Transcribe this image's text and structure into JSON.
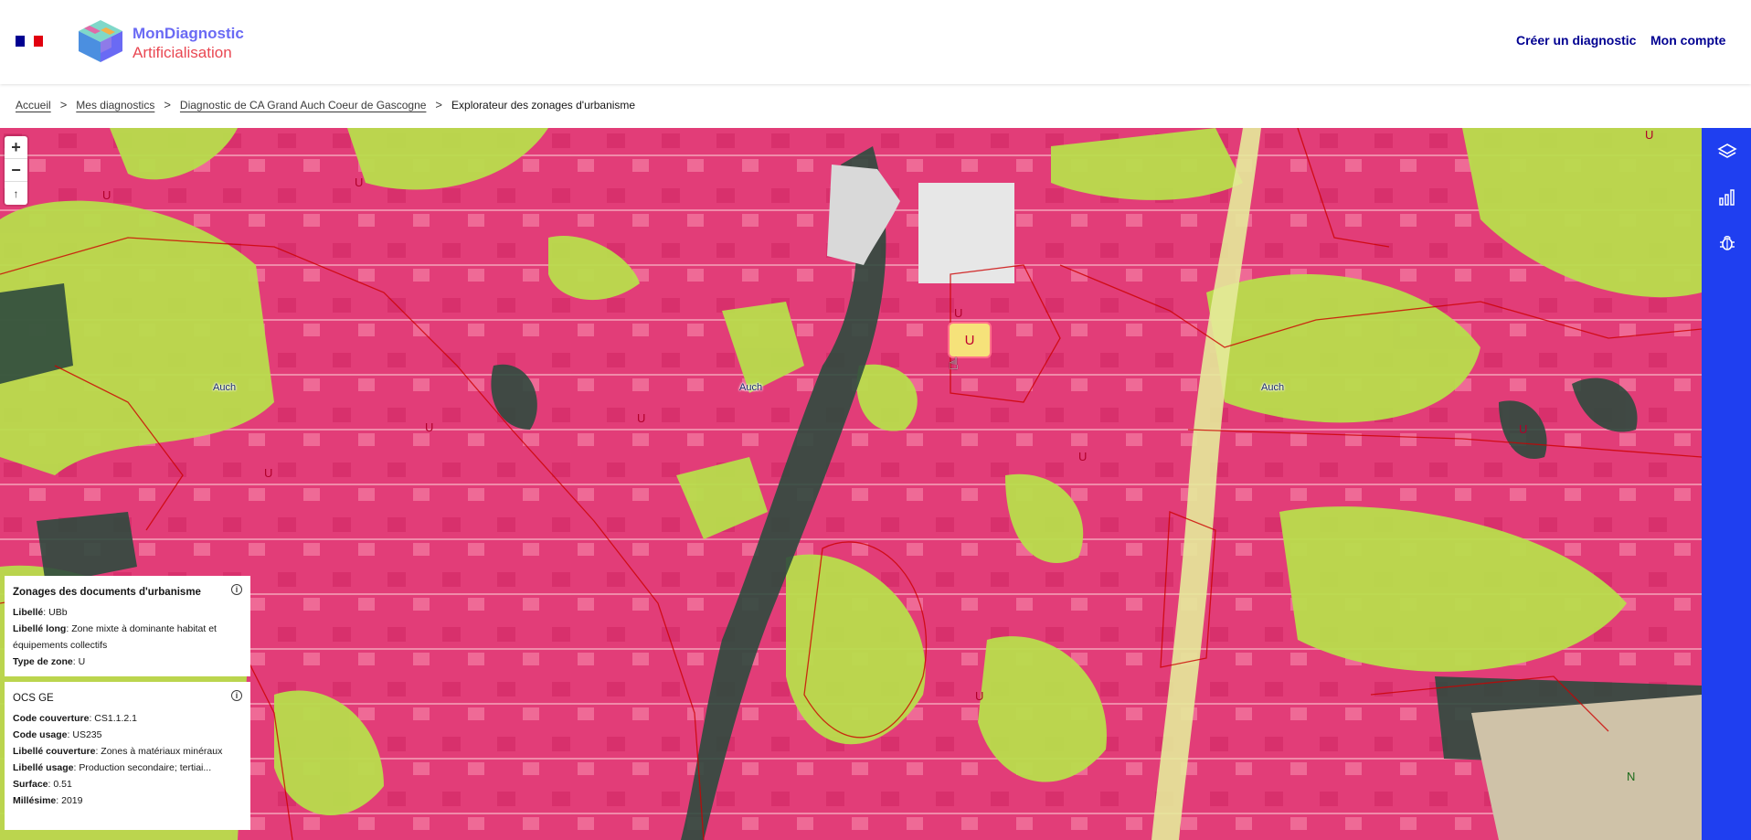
{
  "header": {
    "brand_line1": "MonDiagnostic",
    "brand_line2": "Artificialisation",
    "nav": [
      {
        "label": "Créer un diagnostic"
      },
      {
        "label": "Mon compte"
      }
    ]
  },
  "breadcrumb": {
    "items": [
      "Accueil",
      "Mes diagnostics",
      "Diagnostic de CA Grand Auch Coeur de Gascogne"
    ],
    "current": "Explorateur des zonages d'urbanisme",
    "separator": ">"
  },
  "map": {
    "zoom_in": "+",
    "zoom_out": "−",
    "reset_north": "↑",
    "places": [
      "Auch",
      "Auch",
      "Auch"
    ],
    "zone_letter": "U",
    "zone_letter_n": "N",
    "colors": {
      "built": "#e23d78",
      "vegetation": "#b8dd4c",
      "water": "#2f4a3e",
      "toolbar": "#1f3ff0"
    }
  },
  "toolbar": {
    "icons": [
      "layers-icon",
      "chart-icon",
      "bug-icon"
    ]
  },
  "panel_zonage": {
    "title": "Zonages des documents d'urbanisme",
    "rows": [
      {
        "key": "Libellé",
        "value": "UBb"
      },
      {
        "key": "Libellé long",
        "value": "Zone mixte à dominante habitat et équipements collectifs"
      },
      {
        "key": "Type de zone",
        "value": "U"
      }
    ]
  },
  "panel_ocsge": {
    "title": "OCS GE",
    "rows": [
      {
        "key": "Code couverture",
        "value": "CS1.1.2.1"
      },
      {
        "key": "Code usage",
        "value": "US235"
      },
      {
        "key": "Libellé couverture",
        "value": "Zones à matériaux minéraux"
      },
      {
        "key": "Libellé usage",
        "value": "Production secondaire; tertiai..."
      },
      {
        "key": "Surface",
        "value": "0.51"
      },
      {
        "key": "Millésime",
        "value": "2019"
      }
    ]
  }
}
